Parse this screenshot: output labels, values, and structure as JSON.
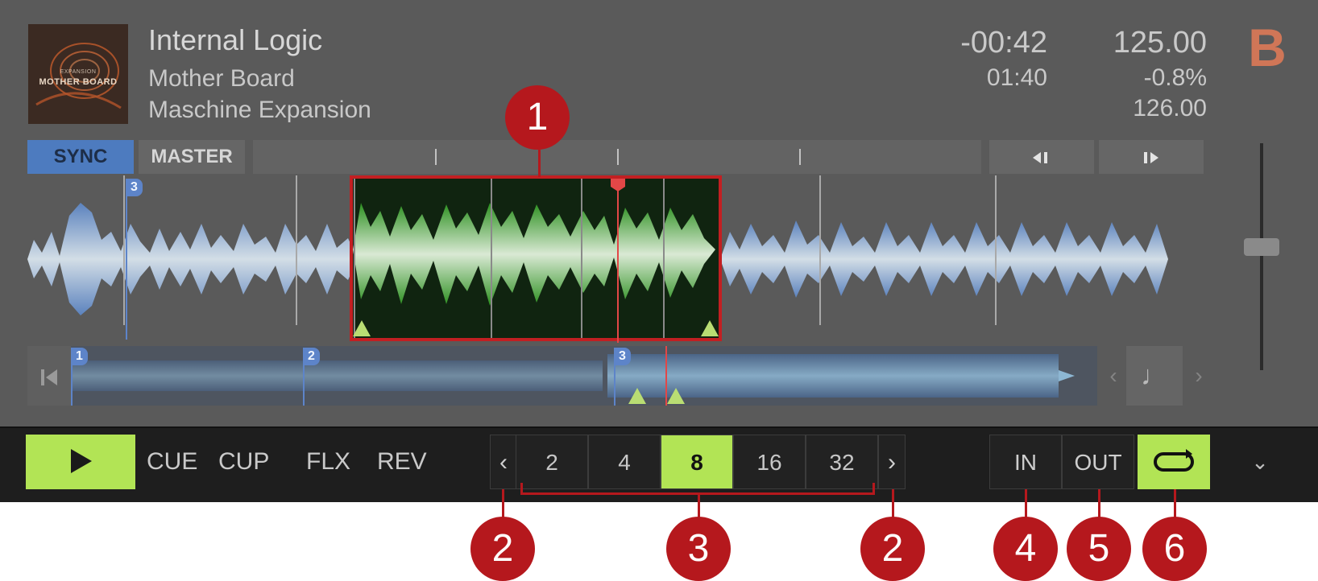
{
  "deck": {
    "letter": "B",
    "artwork": {
      "line1": "EXPANSION",
      "line2": "MOTHER BOARD"
    },
    "track": {
      "title": "Internal Logic",
      "artist": "Mother Board",
      "album": "Maschine Expansion"
    },
    "time": {
      "remaining": "-00:42",
      "elapsed": "01:40"
    },
    "tempo": {
      "bpm": "125.00",
      "pitch": "-0.8%",
      "original_bpm": "126.00"
    },
    "sync_label": "SYNC",
    "master_label": "MASTER",
    "cue_points": [
      "3"
    ],
    "overview_cues": [
      "1",
      "2",
      "3"
    ]
  },
  "transport": {
    "play_label": "",
    "cue": "CUE",
    "cup": "CUP",
    "flx": "FLX",
    "rev": "REV"
  },
  "loop": {
    "sizes": [
      "2",
      "4",
      "8",
      "16",
      "32"
    ],
    "active": "8",
    "in": "IN",
    "out": "OUT"
  },
  "callouts": [
    "1",
    "2",
    "3",
    "2",
    "4",
    "5",
    "6"
  ],
  "colors": {
    "accent": "#b2e455",
    "callout": "#b5181d",
    "deck_letter": "#d07657",
    "sync": "#4d7bbf"
  }
}
